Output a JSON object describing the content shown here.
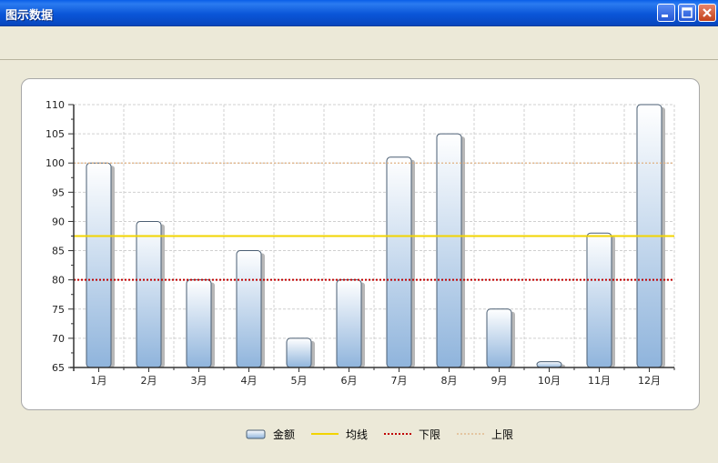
{
  "window": {
    "title": "图示数据"
  },
  "colors": {
    "bar_top": "#FFFFFF",
    "bar_bottom": "#8FB4DC",
    "bar_stroke": "#4A5E73",
    "avg_line": "#F2D400",
    "lower_line": "#C00000",
    "upper_line": "#E0B080"
  },
  "chart_data": {
    "type": "bar",
    "categories": [
      "1月",
      "2月",
      "3月",
      "4月",
      "5月",
      "6月",
      "7月",
      "8月",
      "9月",
      "10月",
      "11月",
      "12月"
    ],
    "series": [
      {
        "name": "金额",
        "values": [
          100,
          90,
          80,
          85,
          70,
          80,
          101,
          105,
          75,
          66,
          88,
          110
        ]
      }
    ],
    "reference_lines": [
      {
        "name": "均线",
        "value": 87.5,
        "style": "solid"
      },
      {
        "name": "下限",
        "value": 80,
        "style": "dotted"
      },
      {
        "name": "上限",
        "value": 100,
        "style": "dotted"
      }
    ],
    "ylim": [
      65,
      110
    ],
    "yticks": [
      65,
      70,
      75,
      80,
      85,
      90,
      95,
      100,
      105,
      110
    ],
    "grid": true,
    "legend_position": "bottom-center",
    "title": "",
    "xlabel": "",
    "ylabel": ""
  },
  "legend": {
    "items": [
      {
        "label": "金额",
        "kind": "bar"
      },
      {
        "label": "均线",
        "kind": "avg"
      },
      {
        "label": "下限",
        "kind": "lower"
      },
      {
        "label": "上限",
        "kind": "upper"
      }
    ]
  }
}
